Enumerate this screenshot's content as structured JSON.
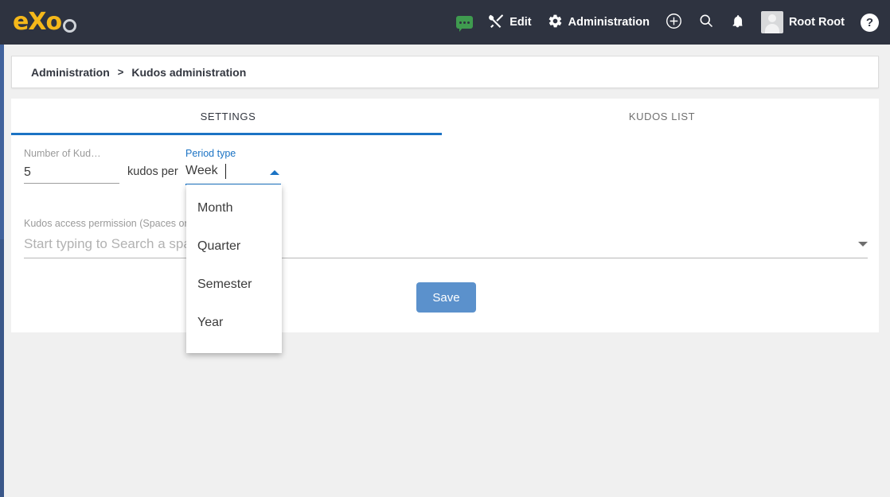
{
  "topbar": {
    "logo_text": "eXo",
    "items": [
      {
        "name": "chat",
        "label": "",
        "icon": "chat-bubble-icon"
      },
      {
        "name": "edit",
        "label": "Edit",
        "icon": "tools-icon"
      },
      {
        "name": "administration",
        "label": "Administration",
        "icon": "gear-icon"
      },
      {
        "name": "add",
        "label": "",
        "icon": "plus-circle-icon"
      },
      {
        "name": "search",
        "label": "",
        "icon": "search-icon"
      },
      {
        "name": "notifications",
        "label": "",
        "icon": "bell-icon"
      },
      {
        "name": "user",
        "label": "Root Root",
        "icon": "avatar-icon"
      },
      {
        "name": "help",
        "label": "?",
        "icon": "help-circle-icon"
      }
    ]
  },
  "breadcrumb": {
    "root": "Administration",
    "separator": ">",
    "current": "Kudos administration"
  },
  "tabs": [
    {
      "label": "SETTINGS",
      "active": true
    },
    {
      "label": "KUDOS LIST",
      "active": false
    }
  ],
  "form": {
    "number_label": "Number of Kud…",
    "number_value": "5",
    "between_text": "kudos per",
    "period_label": "Period type",
    "period_value": "Week",
    "permission_label": "Kudos access permission (Spaces only)",
    "permission_placeholder": "Start typing to Search a space",
    "permission_value": "",
    "save_label": "Save"
  },
  "dropdown": {
    "open": true,
    "options": [
      {
        "label": "Month"
      },
      {
        "label": "Quarter"
      },
      {
        "label": "Semester"
      },
      {
        "label": "Year"
      }
    ]
  },
  "colors": {
    "topbar_bg": "#2e3340",
    "logo_yellow": "#f5b81a",
    "accent_blue": "#1b73c4",
    "save_blue": "#5b91cc",
    "page_bg": "#f0f0f0",
    "chat_green": "#3f9b4f"
  }
}
